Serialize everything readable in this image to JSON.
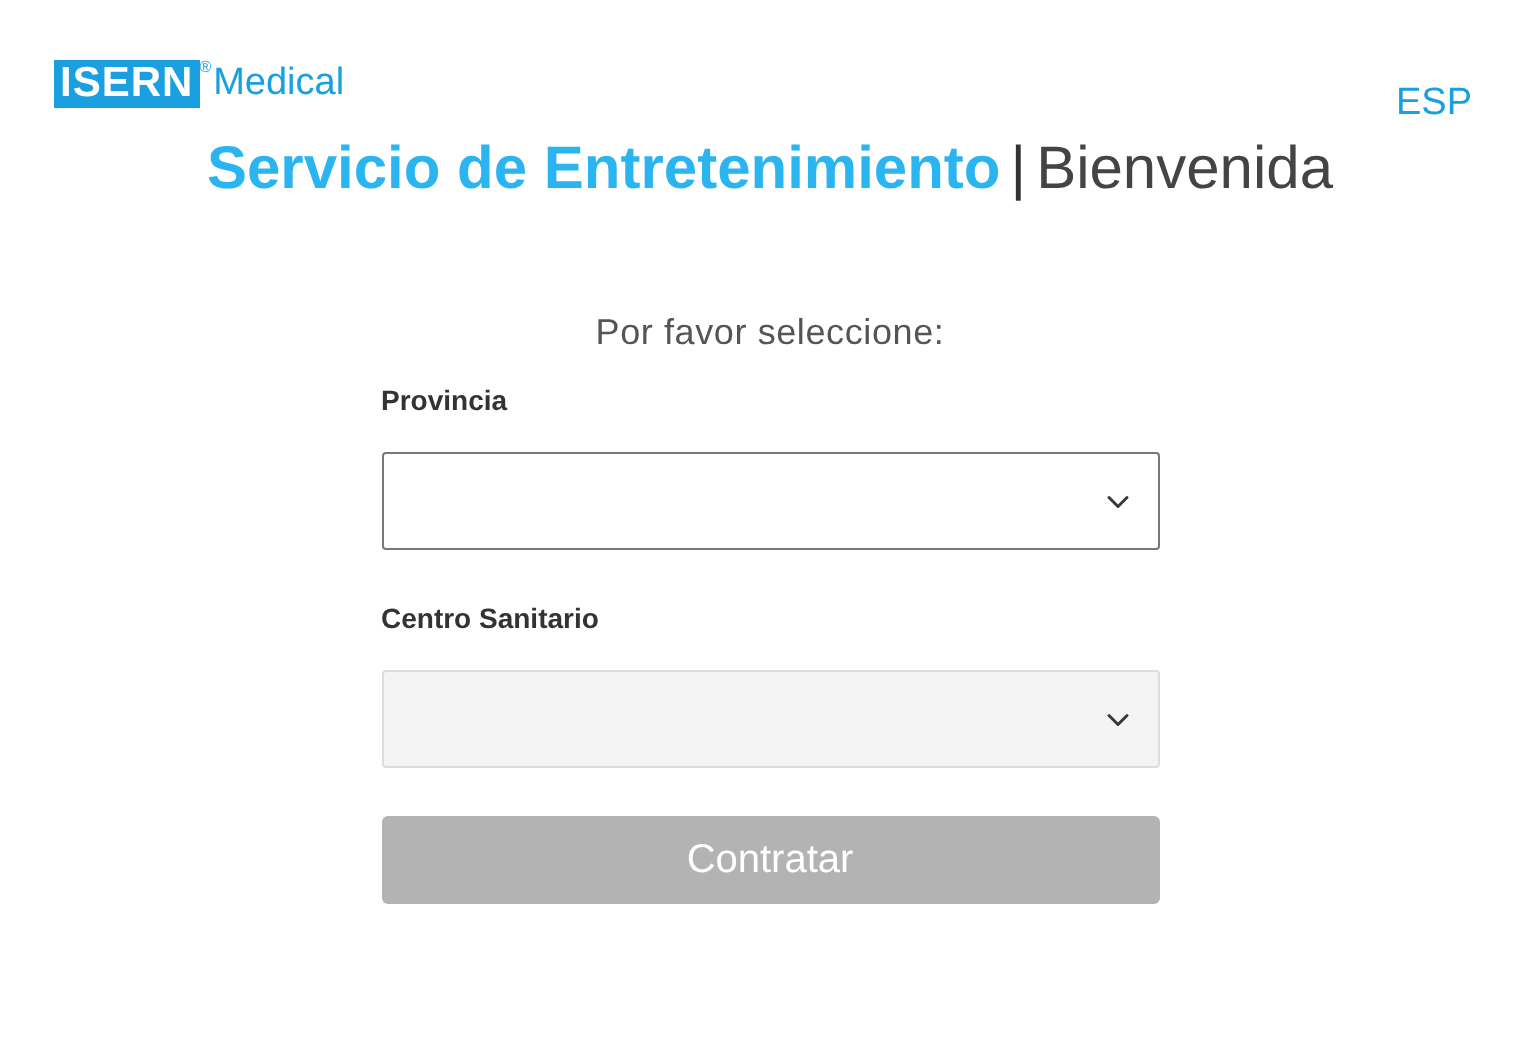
{
  "logo": {
    "mark": "ISERN",
    "registered": "®",
    "word": "Medical"
  },
  "language": "ESP",
  "title": {
    "main": "Servicio de Entretenimiento",
    "separator": "|",
    "subtitle": "Bienvenida"
  },
  "prompt": "Por favor seleccione:",
  "fields": [
    {
      "label": "Provincia",
      "disabled": false
    },
    {
      "label": "Centro Sanitario",
      "disabled": true
    }
  ],
  "submit": {
    "label": "Contratar",
    "disabled": true
  }
}
